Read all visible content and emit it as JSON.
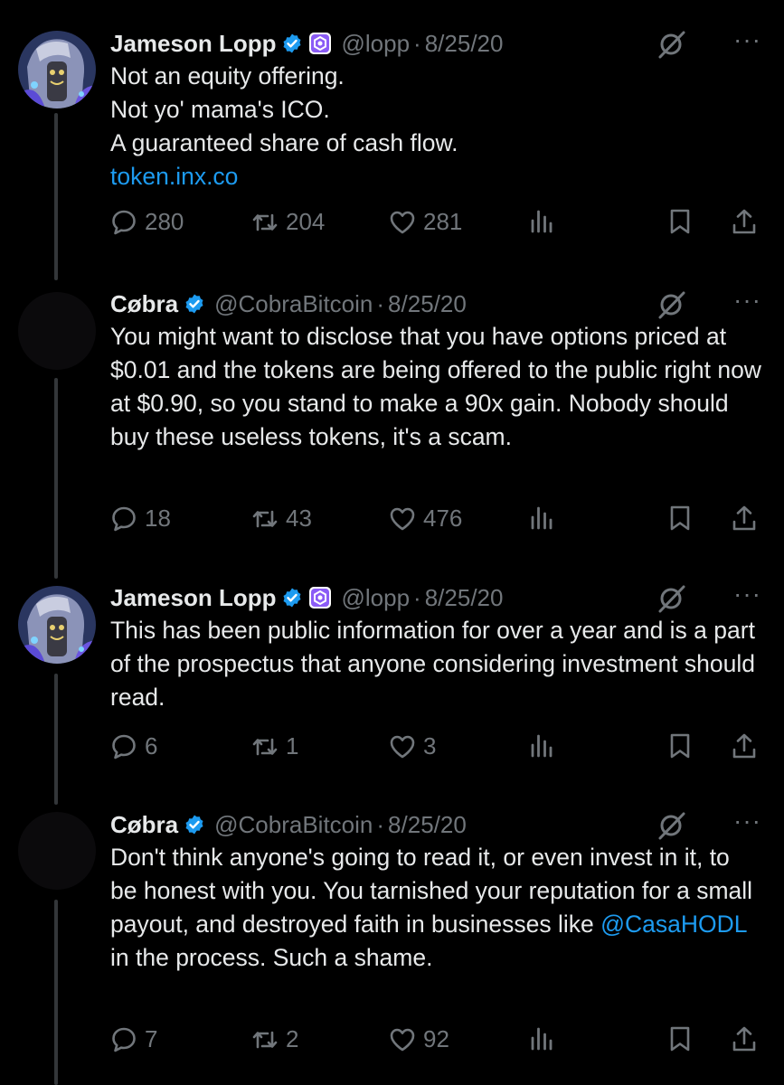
{
  "tweets": [
    {
      "name": "Jameson Lopp",
      "handle": "@lopp",
      "date": "8/25/20",
      "text": "Not an equity offering.\nNot yo' mama's ICO.\nA guaranteed share of cash flow.",
      "link": "token.inx.co",
      "replies": "280",
      "retweets": "204",
      "likes": "281"
    },
    {
      "name": "Cøbra",
      "handle": "@CobraBitcoin",
      "date": "8/25/20",
      "text": "You might want to disclose that you have options priced at $0.01 and the tokens are being offered to the public right now at $0.90, so you stand to make a 90x gain. Nobody should buy these useless tokens, it's a scam.",
      "replies": "18",
      "retweets": "43",
      "likes": "476"
    },
    {
      "name": "Jameson Lopp",
      "handle": "@lopp",
      "date": "8/25/20",
      "text": "This has been public information for over a year and is a part of the prospectus that anyone considering investment should read.",
      "replies": "6",
      "retweets": "1",
      "likes": "3"
    },
    {
      "name": "Cøbra",
      "handle": "@CobraBitcoin",
      "date": "8/25/20",
      "text_before": "Don't think anyone's going to read it, or even invest in it, to be honest with you. You tarnished your reputation for a small payout, and destroyed faith in businesses like ",
      "mention": "@CasaHODL",
      "text_after": " in the process. Such a shame.",
      "replies": "7",
      "retweets": "2",
      "likes": "92"
    }
  ],
  "separator": "·",
  "more_glyph": "···",
  "colors": {
    "background": "#000000",
    "text": "#e7e9ea",
    "muted": "#71767b",
    "link": "#1d9bf0",
    "verified": "#1d9bf0",
    "affiliate": "#8b5cf6"
  },
  "icons": [
    "verified-badge-icon",
    "affiliate-badge-icon",
    "grok-icon",
    "more-icon",
    "reply-icon",
    "retweet-icon",
    "like-icon",
    "views-icon",
    "bookmark-icon",
    "share-icon"
  ]
}
